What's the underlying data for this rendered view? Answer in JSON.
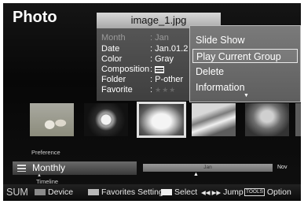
{
  "screen_title": "Photo",
  "info_panel": {
    "filename": "image_1.jpg",
    "rows": [
      {
        "key": "Month",
        "value": ": Jan"
      },
      {
        "key": "Date",
        "value": ": Jan.01.2"
      },
      {
        "key": "Color",
        "value": ": Gray"
      },
      {
        "key": "Composition",
        "value": ":"
      },
      {
        "key": "Folder",
        "value": ": P-other"
      },
      {
        "key": "Favorite",
        "value": ":"
      }
    ],
    "favorite_stars": "★★★"
  },
  "context_menu": {
    "items": [
      "Slide Show",
      "Play Current Group",
      "Delete",
      "Information"
    ],
    "selected_index": 1,
    "more_indicator": "▼"
  },
  "group": {
    "preference_label": "Preference",
    "current": "Monthly",
    "timeline_label": "Timeline",
    "caret": "▲"
  },
  "timeline": {
    "current_month": "Jan",
    "next_month": "Nov",
    "marker": "▲"
  },
  "bottom_bar": {
    "sum": "SUM",
    "device": "Device",
    "favorites": "Favorites Setting",
    "select": "Select",
    "jump_arrows": "◀◀ ▶▶",
    "jump": "Jump",
    "tools_key": "TOOLS",
    "option": "Option"
  },
  "colors": {
    "background": "#0b0b0b",
    "menu": "#6b6b6b",
    "selection_border": "#e8e8e8"
  }
}
